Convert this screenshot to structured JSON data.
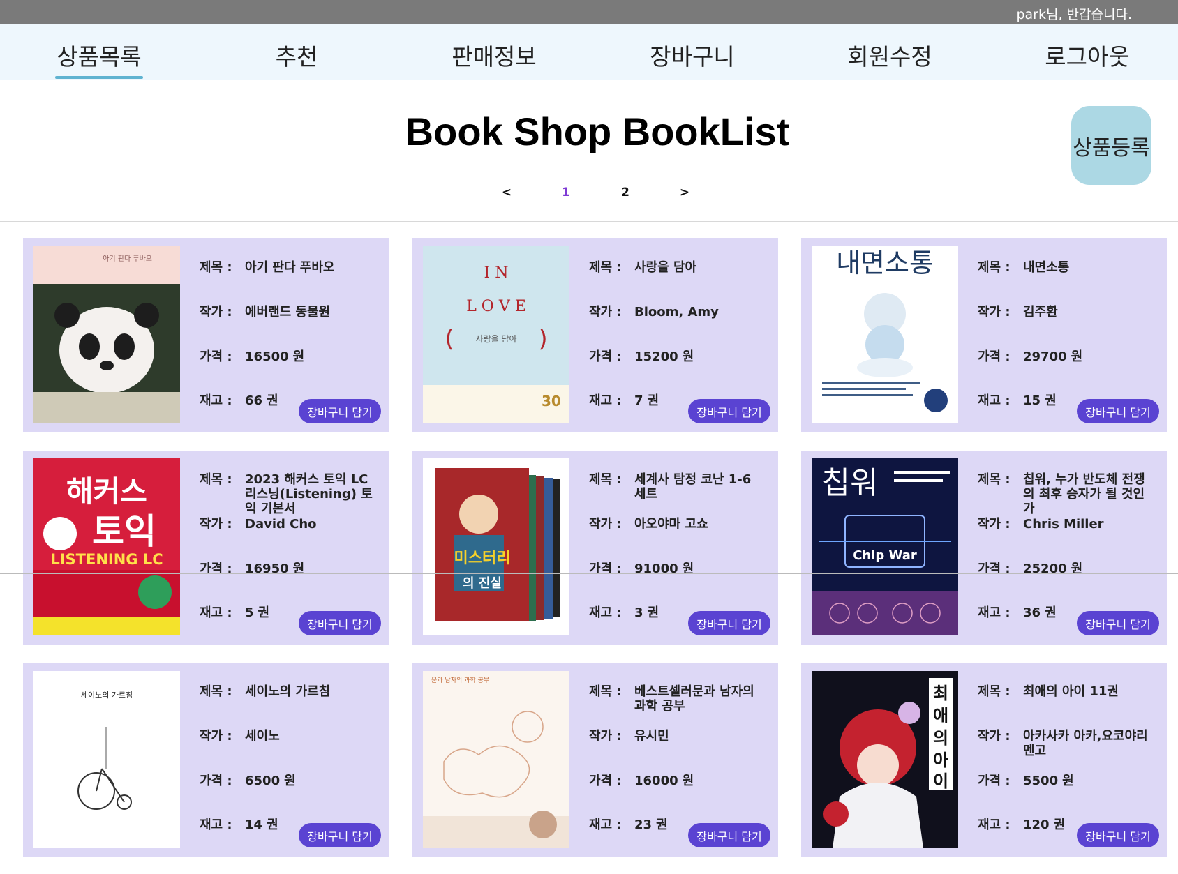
{
  "header": {
    "greeting": "park님, 반갑습니다."
  },
  "nav": [
    {
      "label": "상품목록",
      "active": true
    },
    {
      "label": "추천"
    },
    {
      "label": "판매정보"
    },
    {
      "label": "장바구니"
    },
    {
      "label": "회원수정"
    },
    {
      "label": "로그아웃"
    }
  ],
  "page": {
    "title": "Book Shop BookList",
    "register_label": "상품등록"
  },
  "pagination": {
    "prev": "<",
    "pages": [
      "1",
      "2"
    ],
    "current": "1",
    "next": ">"
  },
  "labels": {
    "title": "제목 :",
    "author": "작가 :",
    "price": "가격 :",
    "stock": "재고 :",
    "price_unit": "원",
    "stock_unit": "권",
    "cart": "장바구니 담기"
  },
  "books": [
    {
      "title": "아기 판다 푸바오",
      "author": "에버랜드 동물원",
      "price": "16500",
      "stock": "66",
      "cover_text": "아기 판다 푸바오"
    },
    {
      "title": "사랑을 담아",
      "author": "Bloom, Amy",
      "price": "15200",
      "stock": "7",
      "cover_text": "I N L O V E"
    },
    {
      "title": "내면소통",
      "author": "김주환",
      "price": "29700",
      "stock": "15",
      "cover_text": "내면소통"
    },
    {
      "title": "2023 해커스 토익 LC 리스닝(Listening) 토익 기본서",
      "author": "David Cho",
      "price": "16950",
      "stock": "5",
      "cover_text": "해커스 토익"
    },
    {
      "title": "세계사 탐정 코난 1-6 세트",
      "author": "아오야마 고쇼",
      "price": "91000",
      "stock": "3",
      "cover_text": "세계사 미스터리"
    },
    {
      "title": "칩워, 누가 반도체 전쟁의 최후 승자가 될 것인가",
      "author": "Chris Miller",
      "price": "25200",
      "stock": "36",
      "cover_text": "칩워"
    },
    {
      "title": "세이노의 가르침",
      "author": "세이노",
      "price": "6500",
      "stock": "14",
      "cover_text": "세이노의 가르침"
    },
    {
      "title": "베스트셀러문과 남자의 과학 공부",
      "author": "유시민",
      "price": "16000",
      "stock": "23",
      "cover_text": "문과 남자의 과학 공부"
    },
    {
      "title": "최애의 아이 11권",
      "author": "아카사카 아카,요코야리 멘고",
      "price": "5500",
      "stock": "120",
      "cover_text": "최애의 아이"
    }
  ]
}
